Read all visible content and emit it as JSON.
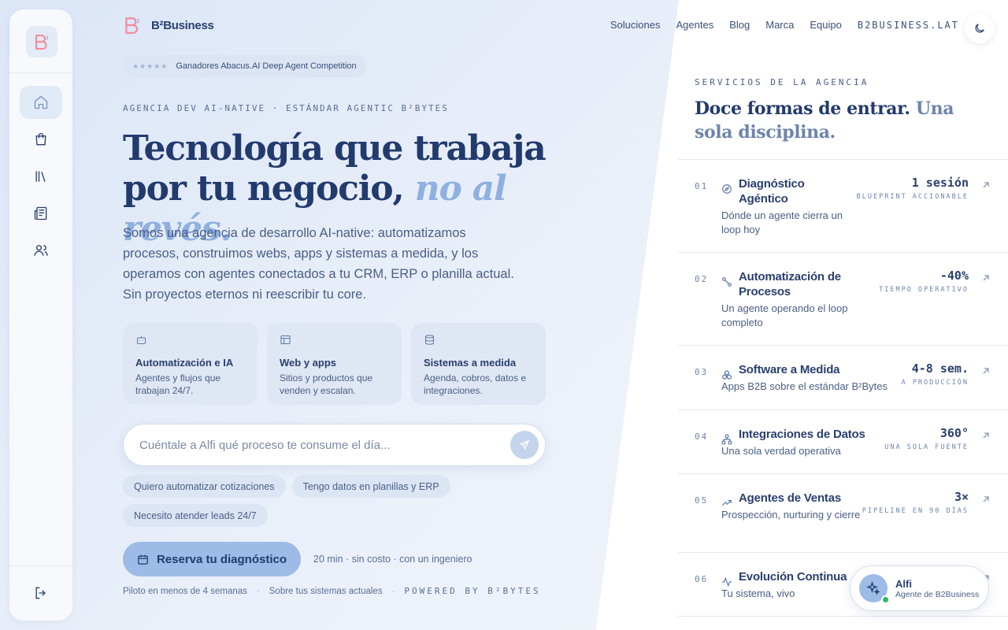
{
  "brand": {
    "name": "B²Business",
    "logo_mark": "B²"
  },
  "nav": {
    "items": [
      "Soluciones",
      "Agentes",
      "Blog",
      "Marca",
      "Equipo"
    ],
    "domain": "B2BUSINESS.LAT"
  },
  "sidebar": {
    "items": [
      {
        "icon": "home-icon",
        "active": true
      },
      {
        "icon": "shopping-bag-icon",
        "active": false
      },
      {
        "icon": "library-icon",
        "active": false
      },
      {
        "icon": "newspaper-icon",
        "active": false
      },
      {
        "icon": "users-icon",
        "active": false
      }
    ],
    "logout_icon": "logout-icon"
  },
  "hero": {
    "badge": "Ganadores Abacus.AI Deep Agent Competition",
    "eyebrow": "AGENCIA DEV AI-NATIVE · ESTÁNDAR AGENTIC B²BYTES",
    "headline_line1": "Tecnología que trabaja",
    "headline_line2": "por tu negocio,",
    "headline_accent": "no al revés.",
    "lead": "Somos una agencia de desarrollo AI-native: automatizamos procesos, construimos webs, apps y sistemas a medida, y los operamos con agentes conectados a tu CRM, ERP o planilla actual. Sin proyectos eternos ni reescribir tu core."
  },
  "cards": [
    {
      "icon": "bot-icon",
      "title": "Automatización e IA",
      "desc": "Agentes y flujos que trabajan 24/7."
    },
    {
      "icon": "layout-icon",
      "title": "Web y apps",
      "desc": "Sitios y productos que venden y escalan."
    },
    {
      "icon": "database-icon",
      "title": "Sistemas a medida",
      "desc": "Agenda, cobros, datos e integraciones."
    }
  ],
  "chat": {
    "placeholder": "Cuéntale a Alfi qué proceso te consume el día...",
    "value": ""
  },
  "chips": [
    "Quiero automatizar cotizaciones",
    "Tengo datos en planillas y ERP",
    "Necesito atender leads 24/7"
  ],
  "cta": {
    "label": "Reserva tu diagnóstico",
    "note": "20 min · sin costo · con un ingeniero"
  },
  "footer": {
    "item1": "Piloto en menos de 4 semanas",
    "item2": "Sobre tus sistemas actuales",
    "powered": "POWERED BY B²BYTES"
  },
  "services": {
    "eyebrow": "SERVICIOS DE LA AGENCIA",
    "title": "Doce formas de entrar.",
    "title_sub": "Una sola disciplina.",
    "items": [
      {
        "num": "01",
        "icon": "compass-icon",
        "name": "Diagnóstico Agéntico",
        "desc": "Dónde un agente cierra un loop hoy",
        "metric": "1 sesión",
        "metric_label": "BLUEPRINT ACCIONABLE"
      },
      {
        "num": "02",
        "icon": "workflow-icon",
        "name": "Automatización de Procesos",
        "desc": "Un agente operando el loop completo",
        "metric": "-40%",
        "metric_label": "TIEMPO OPERATIVO"
      },
      {
        "num": "03",
        "icon": "boxes-icon",
        "name": "Software a Medida",
        "desc": "Apps B2B sobre el estándar B²Bytes",
        "metric": "4-8 sem.",
        "metric_label": "A PRODUCCIÓN"
      },
      {
        "num": "04",
        "icon": "network-icon",
        "name": "Integraciones de Datos",
        "desc": "Una sola verdad operativa",
        "metric": "360°",
        "metric_label": "UNA SOLA FUENTE"
      },
      {
        "num": "05",
        "icon": "trending-up-icon",
        "name": "Agentes de Ventas",
        "desc": "Prospección, nurturing y cierre",
        "metric": "3×",
        "metric_label": "PIPELINE EN 90 DÍAS"
      },
      {
        "num": "06",
        "icon": "activity-icon",
        "name": "Evolución Continua",
        "desc": "Tu sistema, vivo",
        "metric": "",
        "metric_label": ""
      }
    ]
  },
  "alfi": {
    "name": "Alfi",
    "subtitle": "Agente de B2Business"
  },
  "colors": {
    "primary": "#223a6e",
    "accent": "#8fb0e0",
    "cta": "#9dbbe6",
    "status_online": "#2dbb6a"
  }
}
